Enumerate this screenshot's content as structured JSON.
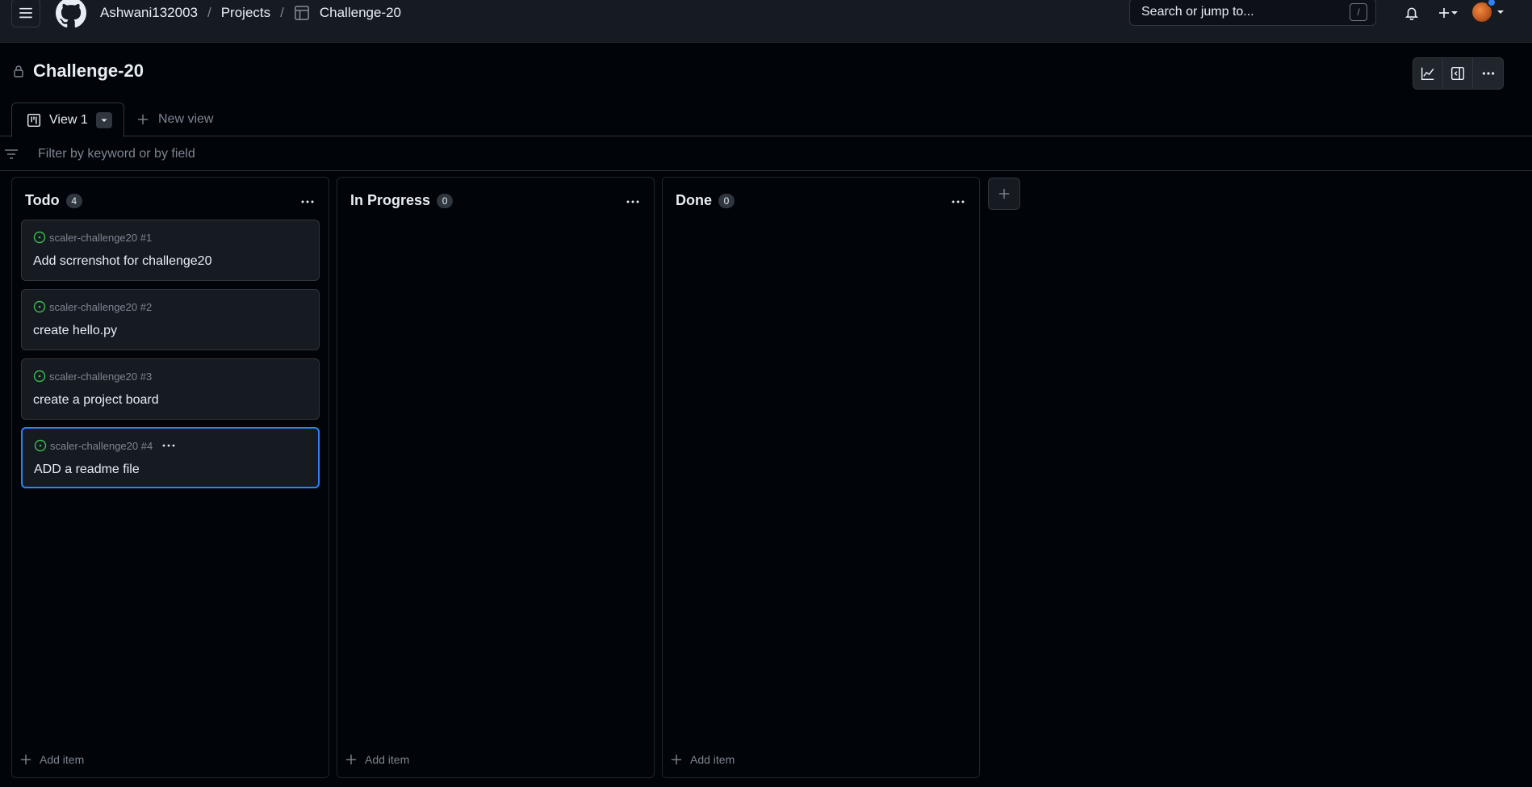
{
  "header": {
    "breadcrumb": [
      "Ashwani132003",
      "Projects",
      "Challenge-20"
    ],
    "breadcrumb_separator": "/",
    "search_placeholder": "Search or jump to...",
    "search_shortcut": "/"
  },
  "project": {
    "title": "Challenge-20",
    "visibility": "private"
  },
  "tabs": {
    "active_label": "View 1",
    "new_view_label": "New view"
  },
  "filter": {
    "placeholder": "Filter by keyword or by field"
  },
  "columns": [
    {
      "title": "Todo",
      "count": "4",
      "add_item_label": "Add item",
      "cards": [
        {
          "repo": "scaler-challenge20 #1",
          "title": "Add scrrenshot for challenge20"
        },
        {
          "repo": "scaler-challenge20 #2",
          "title": "create hello.py"
        },
        {
          "repo": "scaler-challenge20 #3",
          "title": "create a project board"
        },
        {
          "repo": "scaler-challenge20 #4",
          "title": "ADD a readme file"
        }
      ]
    },
    {
      "title": "In Progress",
      "count": "0",
      "add_item_label": "Add item",
      "cards": []
    },
    {
      "title": "Done",
      "count": "0",
      "add_item_label": "Add item",
      "cards": []
    }
  ],
  "colors": {
    "background": "#010409",
    "header_bg": "#161b22",
    "card_bg": "#161b22",
    "border": "#30363d",
    "accent_blue": "#2f81f7",
    "issue_open_green": "#3fb950",
    "muted_text": "#7d8590"
  },
  "icons": {
    "menu": "hamburger-icon",
    "logo": "github-logo-icon",
    "project": "table-icon",
    "notifications": "bell-icon",
    "create": "plus-icon",
    "lock": "lock-icon",
    "insights": "graph-icon",
    "side_panel": "sidebar-expand-icon",
    "more": "kebab-horizontal-icon",
    "board": "project-board-icon",
    "filter": "filter-icon",
    "issue_open": "issue-opened-icon"
  }
}
